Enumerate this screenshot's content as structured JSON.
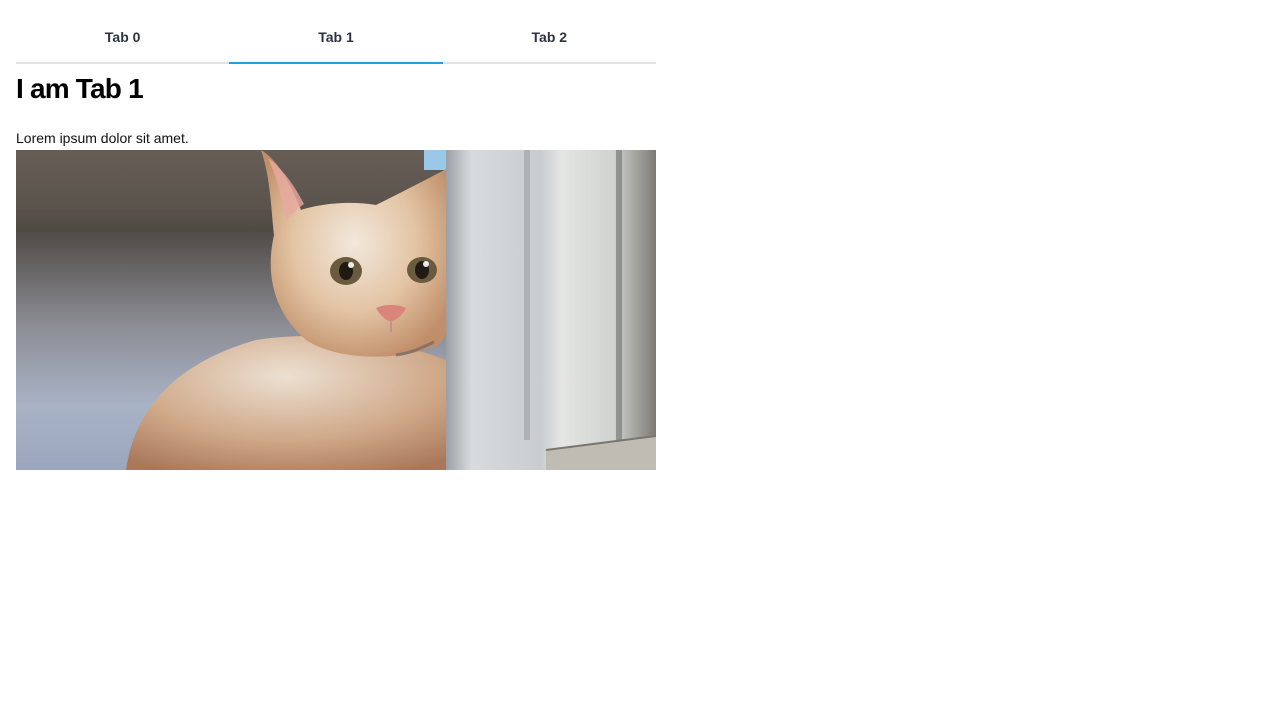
{
  "tabs": [
    {
      "label": "Tab 0",
      "active": false
    },
    {
      "label": "Tab 1",
      "active": true
    },
    {
      "label": "Tab 2",
      "active": false
    }
  ],
  "panel": {
    "title": "I am Tab 1",
    "text": "Lorem ipsum dolor sit amet."
  },
  "image": {
    "subject": "kitten-photo",
    "aria_label": "kitten"
  },
  "colors": {
    "tab_text": "#2d3340",
    "active_indicator": "#1aa3e0",
    "tab_border": "#e2e2e2"
  }
}
